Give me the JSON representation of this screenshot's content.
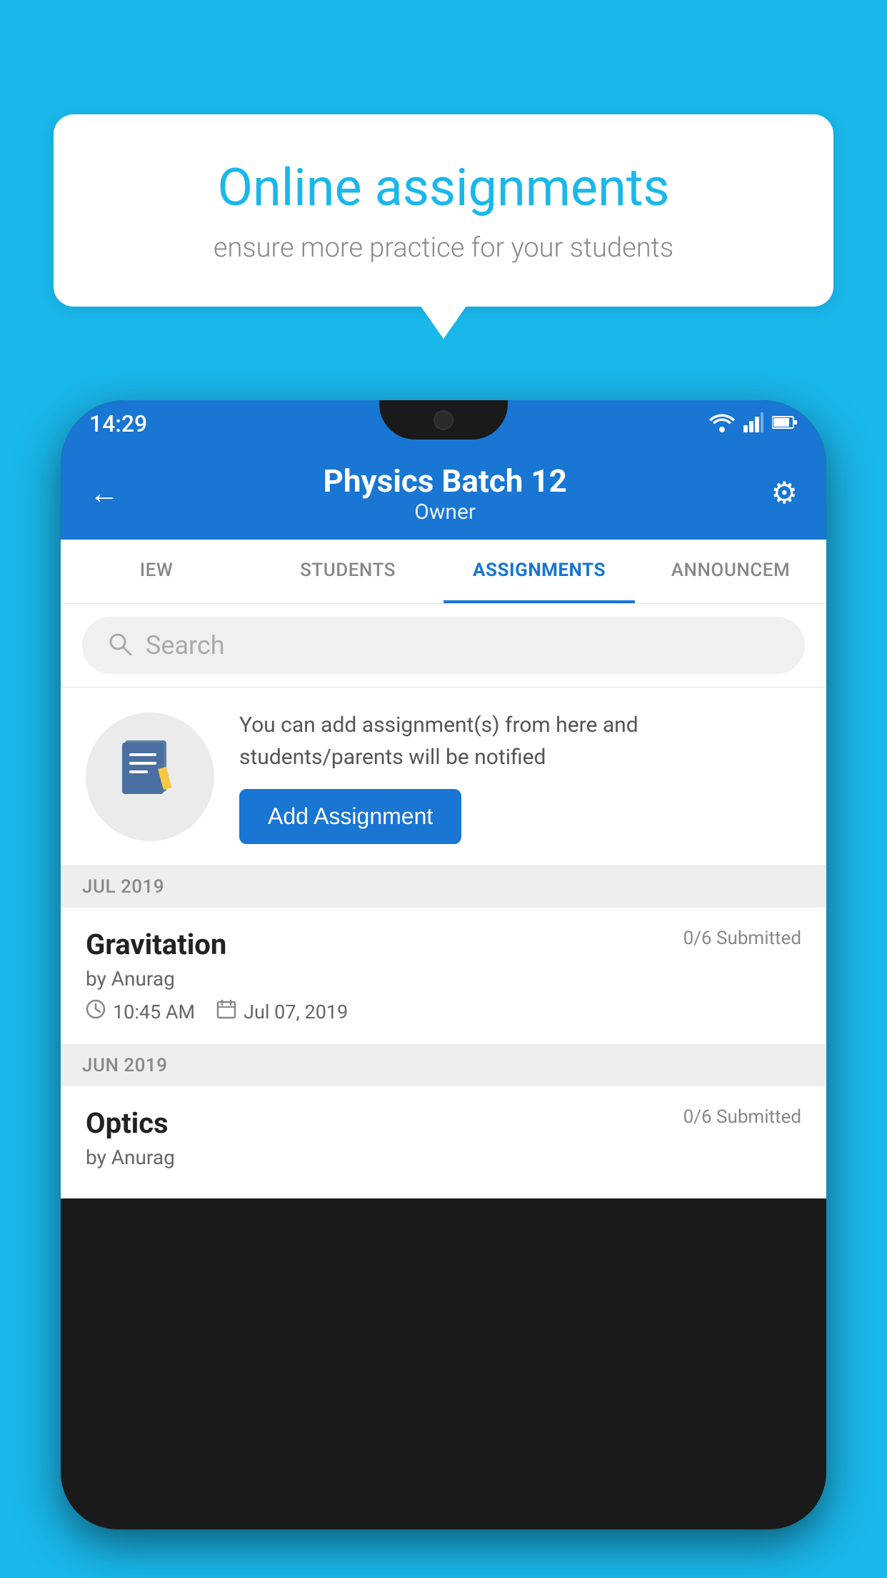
{
  "background": {
    "color": "#1ab7ea"
  },
  "speech_bubble": {
    "title": "Online assignments",
    "subtitle": "ensure more practice for your students"
  },
  "status_bar": {
    "time": "14:29",
    "wifi": "▼",
    "signal": "▲",
    "battery": "▮"
  },
  "header": {
    "title": "Physics Batch 12",
    "subtitle": "Owner",
    "back_label": "←",
    "settings_label": "⚙"
  },
  "tabs": [
    {
      "label": "IEW",
      "active": false
    },
    {
      "label": "STUDENTS",
      "active": false
    },
    {
      "label": "ASSIGNMENTS",
      "active": true
    },
    {
      "label": "ANNOUNCEM",
      "active": false
    }
  ],
  "search": {
    "placeholder": "Search"
  },
  "info_card": {
    "description": "You can add assignment(s) from here and students/parents will be notified",
    "button_label": "Add Assignment"
  },
  "sections": [
    {
      "month": "JUL 2019",
      "assignments": [
        {
          "title": "Gravitation",
          "submitted": "0/6 Submitted",
          "author": "by Anurag",
          "time": "10:45 AM",
          "date": "Jul 07, 2019"
        }
      ]
    },
    {
      "month": "JUN 2019",
      "assignments": [
        {
          "title": "Optics",
          "submitted": "0/6 Submitted",
          "author": "by Anurag",
          "time": "",
          "date": ""
        }
      ]
    }
  ]
}
